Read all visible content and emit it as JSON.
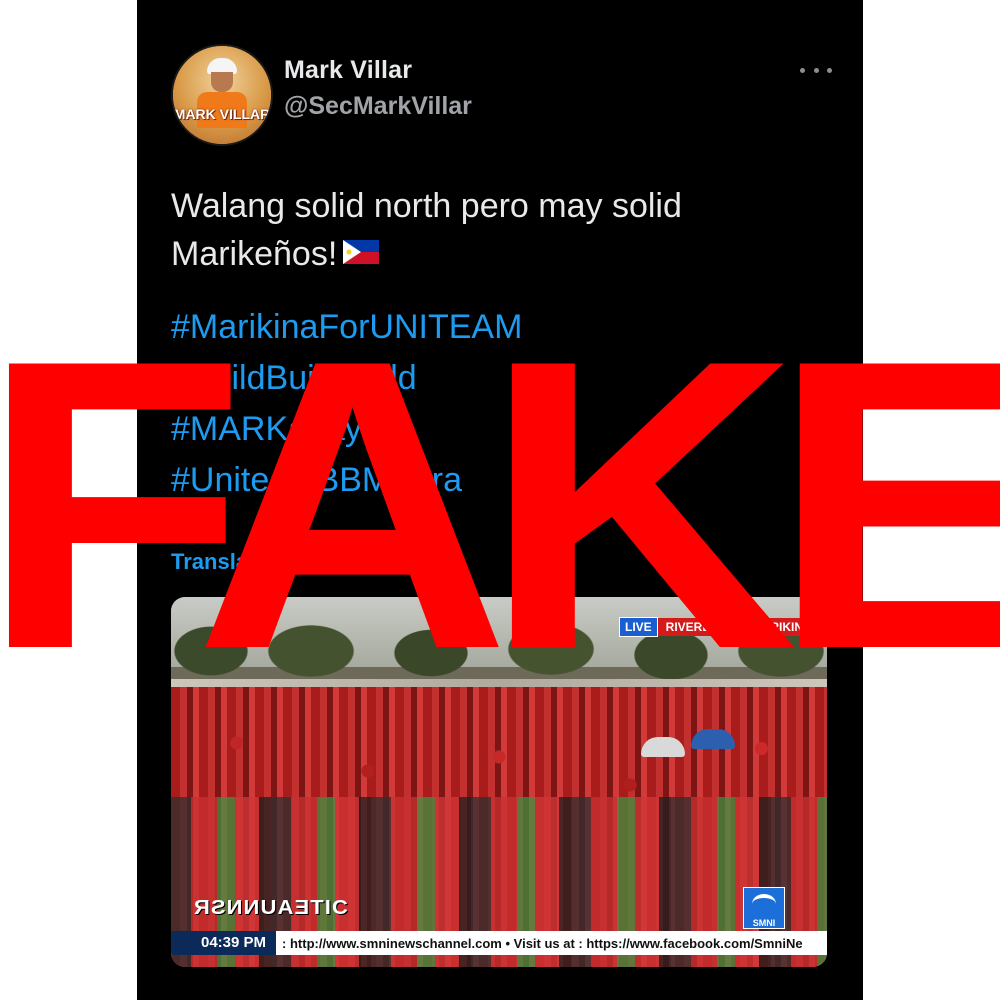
{
  "tweet": {
    "author": {
      "name": "Mark Villar",
      "handle": "@SecMarkVillar",
      "avatar_text": "MARK VILLAR"
    },
    "body": "Walang solid north pero may solid Marikeños!",
    "flag_icon": "philippines-flag-icon",
    "hashtags": [
      "#MarikinaForUNITEAM",
      "#BuildBuildBuild",
      "#MARKabayan",
      "#UniteamBBMSara"
    ],
    "translate_label": "Translate Tweet",
    "more_icon": "more-horizontal-icon"
  },
  "media": {
    "live_label": "LIVE",
    "location": "RIVERBANKS, MARIKINA",
    "time": "04:39 PM",
    "ticker": ": http://www.smninewschannel.com • Visit us at : https://www.facebook.com/SmniNe",
    "channel_logo": "SMNI",
    "show_graphic": "ЯƧИИUAƎTIC"
  },
  "overlay": {
    "stamp_text": "FAKE",
    "stamp_color": "#ff0000"
  },
  "colors": {
    "background": "#000000",
    "link": "#1d9bf0",
    "text": "#e7e9ea"
  }
}
